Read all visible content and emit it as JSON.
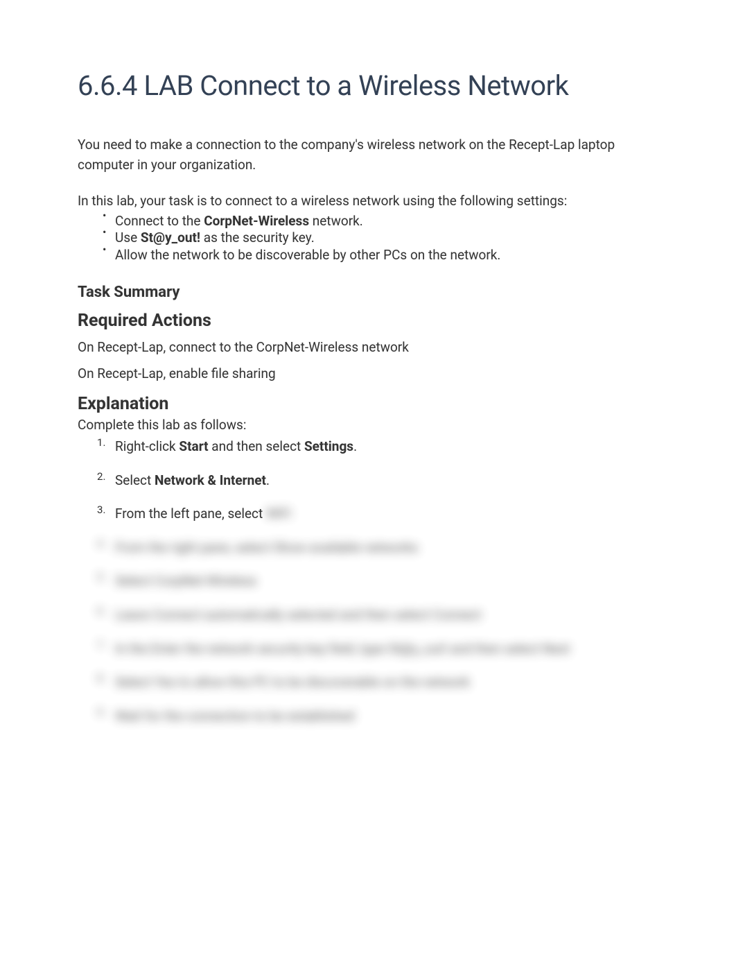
{
  "title": "6.6.4 LAB Connect to a Wireless Network",
  "intro": "You need to make a connection to the company's wireless network on the Recept-Lap laptop computer in your organization.",
  "task_intro": "In this lab, your task is to connect to a wireless network using the following settings:",
  "bullets": {
    "b1_pre": "Connect to the ",
    "b1_bold": "CorpNet-Wireless",
    "b1_post": " network.",
    "b2_pre": "Use ",
    "b2_bold": "St@y_out!",
    "b2_post": " as the security key.",
    "b3": "Allow the network to be discoverable by other PCs on the network."
  },
  "section_task_summary": "Task Summary",
  "section_required_actions": "Required Actions",
  "action1": "On Recept-Lap, connect to the CorpNet-Wireless network",
  "action2": "On Recept-Lap, enable file sharing",
  "section_explanation": "Explanation",
  "explain_intro": "Complete this lab as follows:",
  "steps": {
    "s1_pre": "Right-click ",
    "s1_bold1": "Start",
    "s1_mid": " and then select ",
    "s1_bold2": "Settings",
    "s1_post": ".",
    "s2_pre": "Select ",
    "s2_bold": "Network & Internet",
    "s2_post": ".",
    "s3_pre": "From the left pane, select ",
    "s3_blur": "WiFi",
    "s4": "From the right pane, select Show available networks",
    "s5": "Select CorpNet-Wireless",
    "s6": "Leave Connect automatically selected and then select Connect",
    "s7": "In the Enter the network security key field, type St@y_out! and then select Next",
    "s8": "Select Yes to allow this PC to be discoverable on the network",
    "s9": "Wait for the connection to be established"
  }
}
